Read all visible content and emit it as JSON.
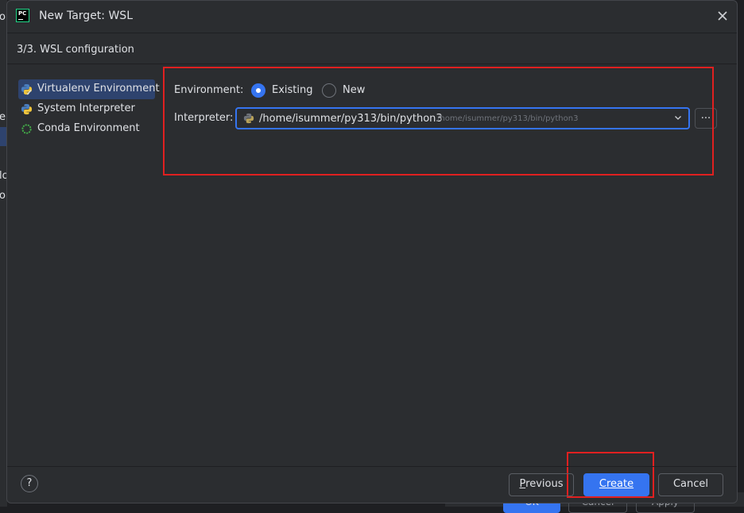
{
  "background": {
    "left_fragments": [
      "o",
      "er",
      "lo",
      "o"
    ],
    "bottom_buttons": [
      "OK",
      "Cancel",
      "Apply"
    ]
  },
  "dialog": {
    "app_logo_text": "PC",
    "title": "New Target: WSL",
    "step_title": "3/3. WSL configuration"
  },
  "sidebar": {
    "items": [
      {
        "label": "Virtualenv Environment",
        "icon": "virtualenv-icon",
        "active": true
      },
      {
        "label": "System Interpreter",
        "icon": "python-icon",
        "active": false
      },
      {
        "label": "Conda Environment",
        "icon": "conda-icon",
        "active": false
      }
    ]
  },
  "form": {
    "environment_label": "Environment:",
    "existing_label": "Existing",
    "new_label": "New",
    "selected": "Existing",
    "interpreter_label": "Interpreter:",
    "interpreter_path": "/home/isummer/py313/bin/python3",
    "interpreter_hint": "/home/isummer/py313/bin/python3",
    "browse_label": "..."
  },
  "footer": {
    "help_label": "?",
    "previous_first": "P",
    "previous_rest": "revious",
    "create_first": "C",
    "create_rest": "reate",
    "cancel_label": "Cancel"
  },
  "colors": {
    "accent": "#3574f0",
    "annotation": "#e02020",
    "dialog_bg": "#2b2d30",
    "selection": "#2e436e"
  }
}
